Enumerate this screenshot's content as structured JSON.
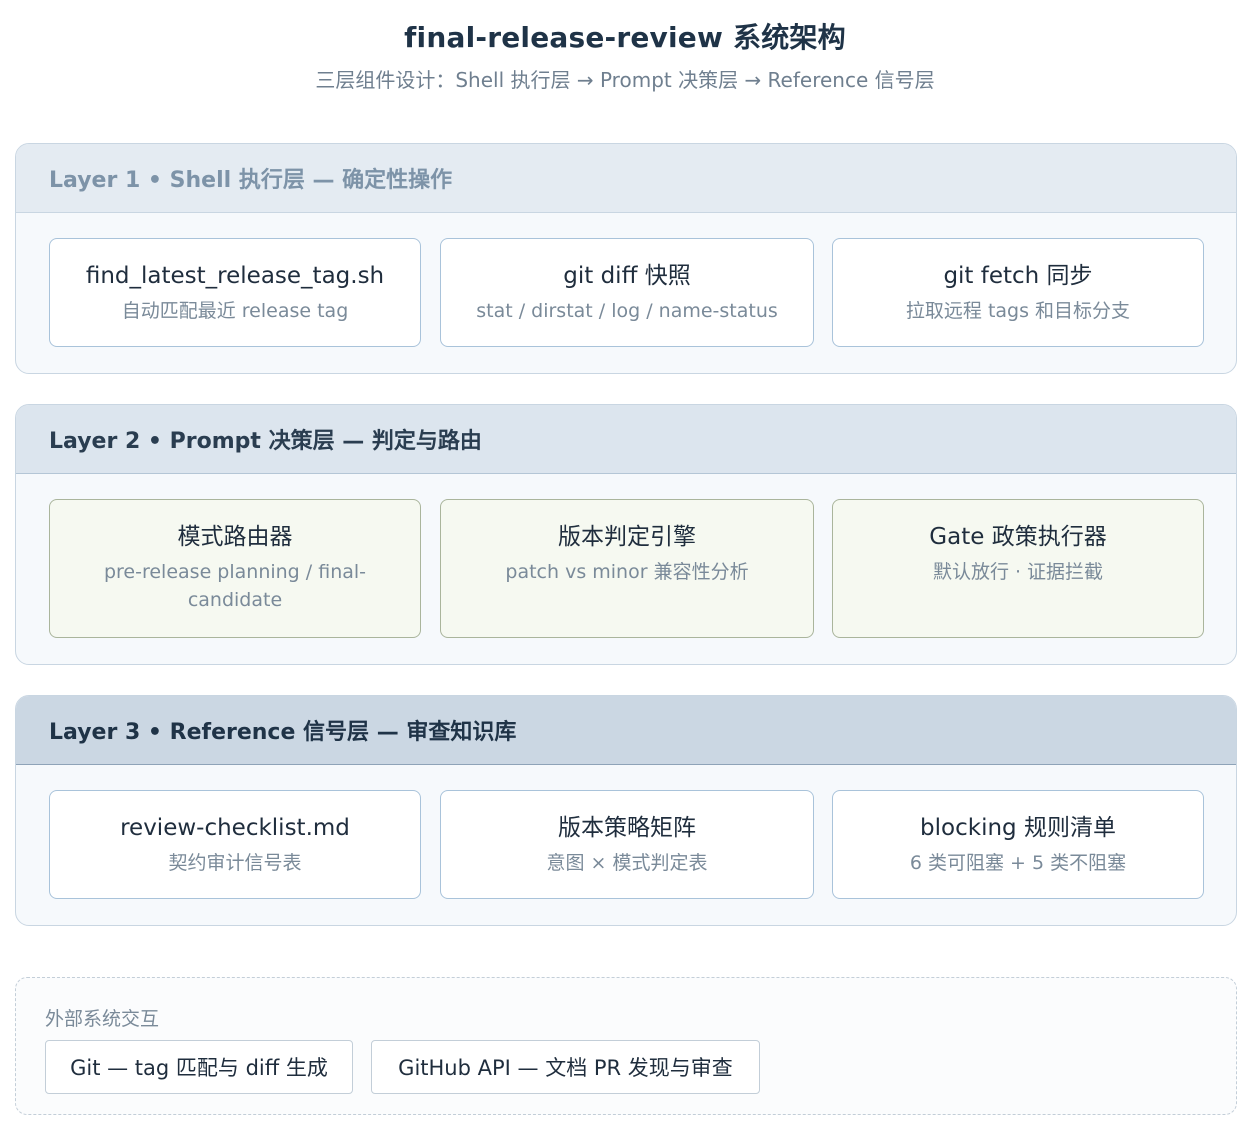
{
  "header": {
    "title": "final-release-review 系统架构",
    "subtitle": "三层组件设计：Shell 执行层 → Prompt 决策层 → Reference 信号层"
  },
  "layers": [
    {
      "title": "Layer 1 • Shell 执行层 — 确定性操作",
      "cards": [
        {
          "title": "find_latest_release_tag.sh",
          "sub": "自动匹配最近 release tag"
        },
        {
          "title": "git diff 快照",
          "sub": "stat / dirstat / log / name-status"
        },
        {
          "title": "git fetch 同步",
          "sub": "拉取远程 tags 和目标分支"
        }
      ]
    },
    {
      "title": "Layer 2 • Prompt 决策层 — 判定与路由",
      "cards": [
        {
          "title": "模式路由器",
          "sub": "pre-release planning / final-candidate"
        },
        {
          "title": "版本判定引擎",
          "sub": "patch vs minor 兼容性分析"
        },
        {
          "title": "Gate 政策执行器",
          "sub": "默认放行 · 证据拦截"
        }
      ]
    },
    {
      "title": "Layer 3 • Reference 信号层 — 审查知识库",
      "cards": [
        {
          "title": "review-checklist.md",
          "sub": "契约审计信号表"
        },
        {
          "title": "版本策略矩阵",
          "sub": "意图 × 模式判定表"
        },
        {
          "title": "blocking 规则清单",
          "sub": "6 类可阻塞 + 5 类不阻塞"
        }
      ]
    }
  ],
  "external": {
    "label": "外部系统交互",
    "items": [
      "Git — tag 匹配与 diff 生成",
      "GitHub API — 文档 PR 发现与审查"
    ]
  }
}
